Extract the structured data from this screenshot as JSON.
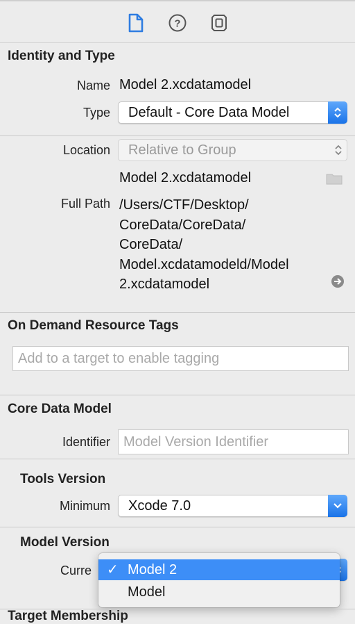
{
  "toolbar": {
    "tabs": [
      {
        "icon": "file-inspector-icon",
        "active": true
      },
      {
        "icon": "quick-help-icon",
        "active": false
      },
      {
        "icon": "identity-inspector-icon",
        "active": false
      }
    ]
  },
  "identity_type": {
    "title": "Identity and Type",
    "name_label": "Name",
    "name_value": "Model 2.xcdatamodel",
    "type_label": "Type",
    "type_value": "Default - Core Data Model",
    "location_label": "Location",
    "location_value": "Relative to Group",
    "location_file": "Model 2.xcdatamodel",
    "full_path_label": "Full Path",
    "full_path_lines": [
      "/Users/CTF/Desktop/",
      "CoreData/CoreData/",
      "CoreData/",
      "Model.xcdatamodeld/Model",
      "2.xcdatamodel"
    ]
  },
  "on_demand": {
    "title": "On Demand Resource Tags",
    "placeholder": "Add to a target to enable tagging"
  },
  "core_data_model": {
    "title": "Core Data Model",
    "identifier_label": "Identifier",
    "identifier_placeholder": "Model Version Identifier",
    "tools_version_title": "Tools Version",
    "minimum_label": "Minimum",
    "minimum_value": "Xcode 7.0",
    "model_version_title": "Model Version",
    "current_label": "Curre"
  },
  "version_menu": {
    "items": [
      {
        "label": "Model 2",
        "selected": true,
        "check": "✓"
      },
      {
        "label": "Model",
        "selected": false,
        "check": ""
      }
    ]
  },
  "target_membership": {
    "title": "Target Membership"
  },
  "colors": {
    "accent": "#3d8ef7",
    "background": "#ececec"
  }
}
